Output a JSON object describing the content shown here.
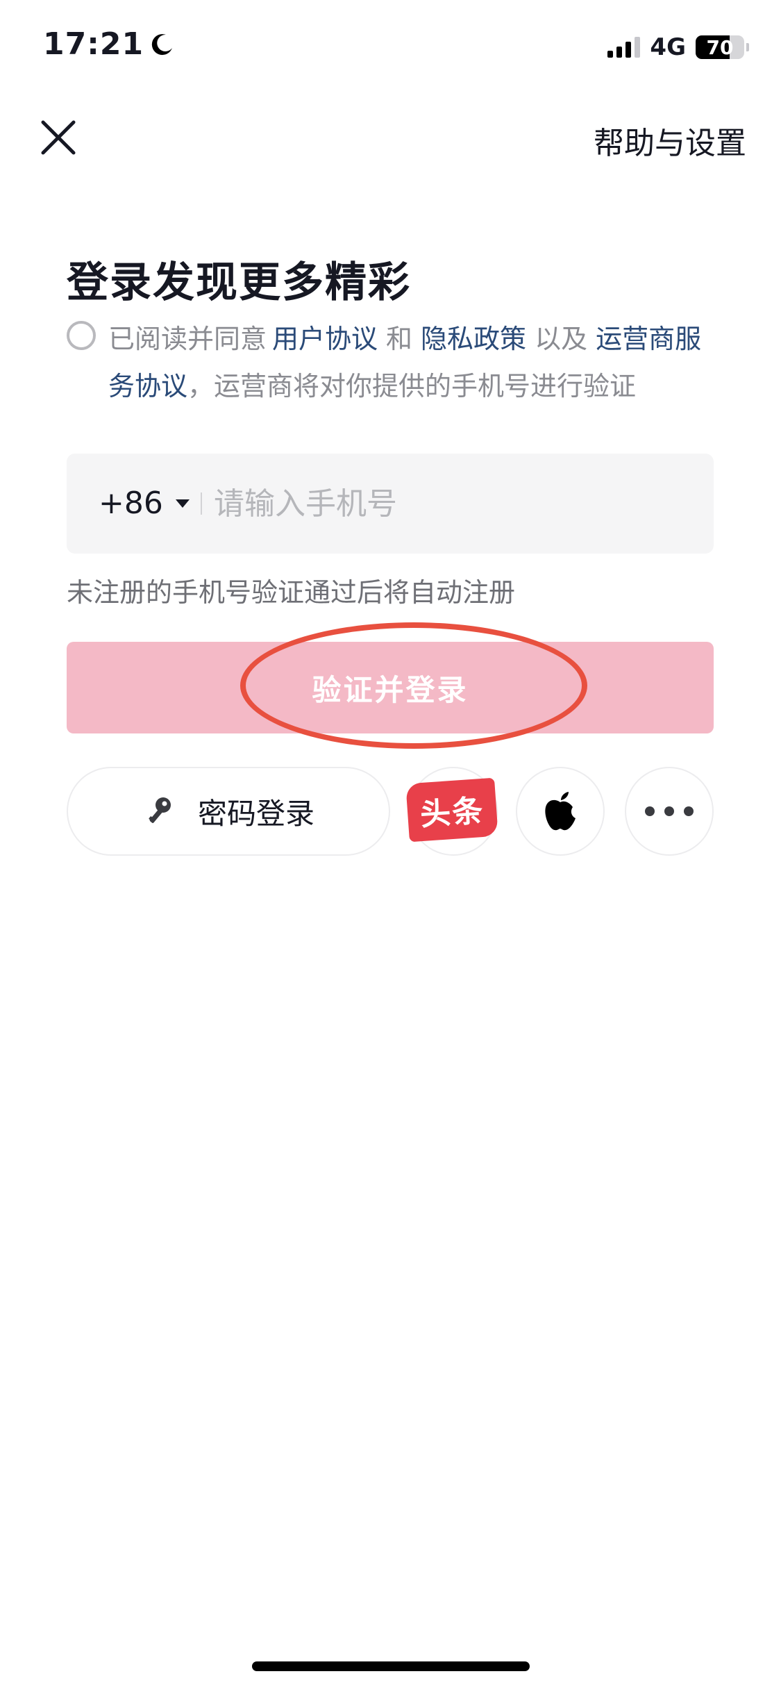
{
  "status_bar": {
    "time": "17:21",
    "network": "4G",
    "battery": "70",
    "battery_level": 0.7
  },
  "nav": {
    "help_label": "帮助与设置"
  },
  "title": "登录发现更多精彩",
  "agreement": {
    "prefix": "已阅读并同意",
    "user_agreement": "用户协议",
    "and": "和",
    "privacy_policy": "隐私政策",
    "as_well_as": "以及",
    "carrier_service": "运营商服务协议",
    "comma": "，",
    "suffix": "运营商将对你提供的手机号进行验证"
  },
  "phone": {
    "country_code": "+86",
    "placeholder": "请输入手机号",
    "value": ""
  },
  "hint": "未注册的手机号验证通过后将自动注册",
  "login_button": "验证并登录",
  "password_login": "密码登录",
  "toutiao_label": "头条",
  "colors": {
    "primary_button": "#f4b9c6",
    "link": "#2a4a78",
    "toutiao": "#e8404a",
    "annotation": "#e8503f"
  }
}
